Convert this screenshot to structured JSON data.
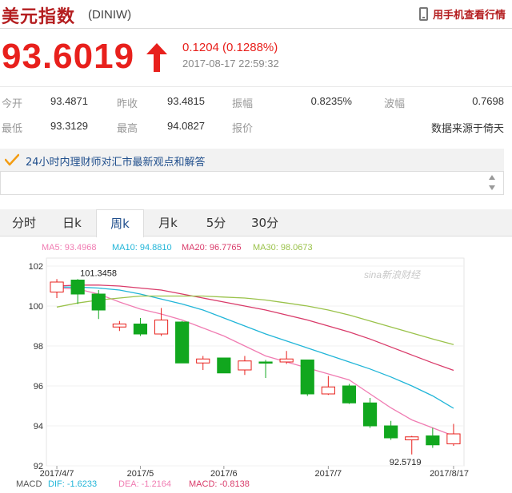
{
  "header": {
    "title": "美元指数",
    "symbol": "(DINIW)",
    "mobile_label": "用手机查看行情",
    "mobile_icon": "phone-icon"
  },
  "quote": {
    "price": "93.6019",
    "change": "0.1204 (0.1288%)",
    "time": "2017-08-17 22:59:32",
    "direction_icon": "arrow-up-icon",
    "up_color": "#e8201c"
  },
  "stats": {
    "open_label": "今开",
    "open": "93.4871",
    "prev_close_label": "昨收",
    "prev_close": "93.4815",
    "amplitude_label": "振幅",
    "amplitude": "0.8235%",
    "fluctuation_label": "波幅",
    "fluctuation": "0.7698",
    "low_label": "最低",
    "low": "93.3129",
    "high_label": "最高",
    "high": "94.0827",
    "quote_label": "报价",
    "source": "数据来源于倚天"
  },
  "advisor": {
    "text": "24小时内理财师对汇市最新观点和解答",
    "icon": "check-mark-icon"
  },
  "tabs": [
    {
      "label": "分时"
    },
    {
      "label": "日k"
    },
    {
      "label": "周k"
    },
    {
      "label": "月k"
    },
    {
      "label": "5分"
    },
    {
      "label": "30分"
    }
  ],
  "active_tab": "周k",
  "watermark": "sina新浪财经",
  "chart_data": {
    "type": "candlestick",
    "up_color": "#e8201c",
    "down_color": "#11a71e",
    "y_ticks": [
      "102",
      "100",
      "98",
      "96",
      "94",
      "92"
    ],
    "ylim": [
      92,
      102.4
    ],
    "x_ticks": [
      {
        "label": "2017/4/7",
        "index": 0
      },
      {
        "label": "2017/5",
        "index": 4
      },
      {
        "label": "2017/6",
        "index": 8
      },
      {
        "label": "2017/7",
        "index": 13
      },
      {
        "label": "2017/8/17",
        "index": 19
      }
    ],
    "candles": [
      {
        "o": 100.7,
        "h": 101.35,
        "l": 100.4,
        "c": 101.2
      },
      {
        "o": 101.3,
        "h": 101.35,
        "l": 100.1,
        "c": 100.6
      },
      {
        "o": 100.6,
        "h": 100.8,
        "l": 99.35,
        "c": 99.8
      },
      {
        "o": 98.95,
        "h": 99.25,
        "l": 98.75,
        "c": 99.1
      },
      {
        "o": 99.1,
        "h": 99.4,
        "l": 98.5,
        "c": 98.6
      },
      {
        "o": 98.6,
        "h": 99.9,
        "l": 98.5,
        "c": 99.3
      },
      {
        "o": 99.2,
        "h": 99.25,
        "l": 97.15,
        "c": 97.15
      },
      {
        "o": 97.15,
        "h": 97.5,
        "l": 96.8,
        "c": 97.35
      },
      {
        "o": 97.4,
        "h": 97.4,
        "l": 96.65,
        "c": 96.65
      },
      {
        "o": 96.8,
        "h": 97.5,
        "l": 96.55,
        "c": 97.25
      },
      {
        "o": 97.2,
        "h": 97.3,
        "l": 96.4,
        "c": 97.15
      },
      {
        "o": 97.2,
        "h": 97.75,
        "l": 97.1,
        "c": 97.35
      },
      {
        "o": 97.3,
        "h": 97.3,
        "l": 95.5,
        "c": 95.6
      },
      {
        "o": 95.6,
        "h": 96.5,
        "l": 95.55,
        "c": 95.95
      },
      {
        "o": 96.0,
        "h": 96.1,
        "l": 95.1,
        "c": 95.15
      },
      {
        "o": 95.15,
        "h": 95.4,
        "l": 93.9,
        "c": 94.0
      },
      {
        "o": 94.0,
        "h": 94.25,
        "l": 93.3,
        "c": 93.4
      },
      {
        "o": 93.3,
        "h": 93.5,
        "l": 92.57,
        "c": 93.45
      },
      {
        "o": 93.5,
        "h": 93.9,
        "l": 92.9,
        "c": 93.05
      },
      {
        "o": 93.1,
        "h": 94.1,
        "l": 93.0,
        "c": 93.6
      }
    ],
    "ma_series": [
      {
        "label": "MA5: 93.4968",
        "color": "#f07cb2",
        "values": [
          100.9,
          100.85,
          100.6,
          100.2,
          99.85,
          99.6,
          99.3,
          98.9,
          98.5,
          98.0,
          97.5,
          97.2,
          96.9,
          96.6,
          96.3,
          95.6,
          94.9,
          94.3,
          93.9,
          93.5
        ]
      },
      {
        "label": "MA10: 94.8810",
        "color": "#21b5d8",
        "values": [
          100.95,
          100.95,
          100.9,
          100.8,
          100.6,
          100.35,
          100.1,
          99.8,
          99.4,
          99.0,
          98.6,
          98.25,
          97.9,
          97.55,
          97.2,
          96.85,
          96.45,
          96.0,
          95.5,
          94.88
        ]
      },
      {
        "label": "MA20: 96.7765",
        "color": "#d93b6a",
        "values": [
          101.0,
          101.05,
          101.05,
          101.0,
          100.9,
          100.8,
          100.6,
          100.4,
          100.2,
          100.0,
          99.8,
          99.55,
          99.3,
          99.0,
          98.7,
          98.35,
          97.95,
          97.55,
          97.15,
          96.78
        ]
      },
      {
        "label": "MA30: 98.0673",
        "color": "#9ac24a",
        "values": [
          99.95,
          100.15,
          100.3,
          100.4,
          100.5,
          100.5,
          100.5,
          100.5,
          100.45,
          100.4,
          100.3,
          100.15,
          100.0,
          99.8,
          99.55,
          99.25,
          98.95,
          98.65,
          98.35,
          98.07
        ]
      }
    ],
    "annotations": {
      "high": "101.3458",
      "high_index": 1,
      "low": "92.5719",
      "low_index": 17
    },
    "macd": {
      "label": "MACD",
      "dif": "DIF: -1.6233",
      "dea": "DEA: -1.2164",
      "macd": "MACD: -0.8138",
      "dif_color": "#21b5d8",
      "dea_color": "#f07cb2",
      "macd_color": "#d93b6a"
    }
  }
}
